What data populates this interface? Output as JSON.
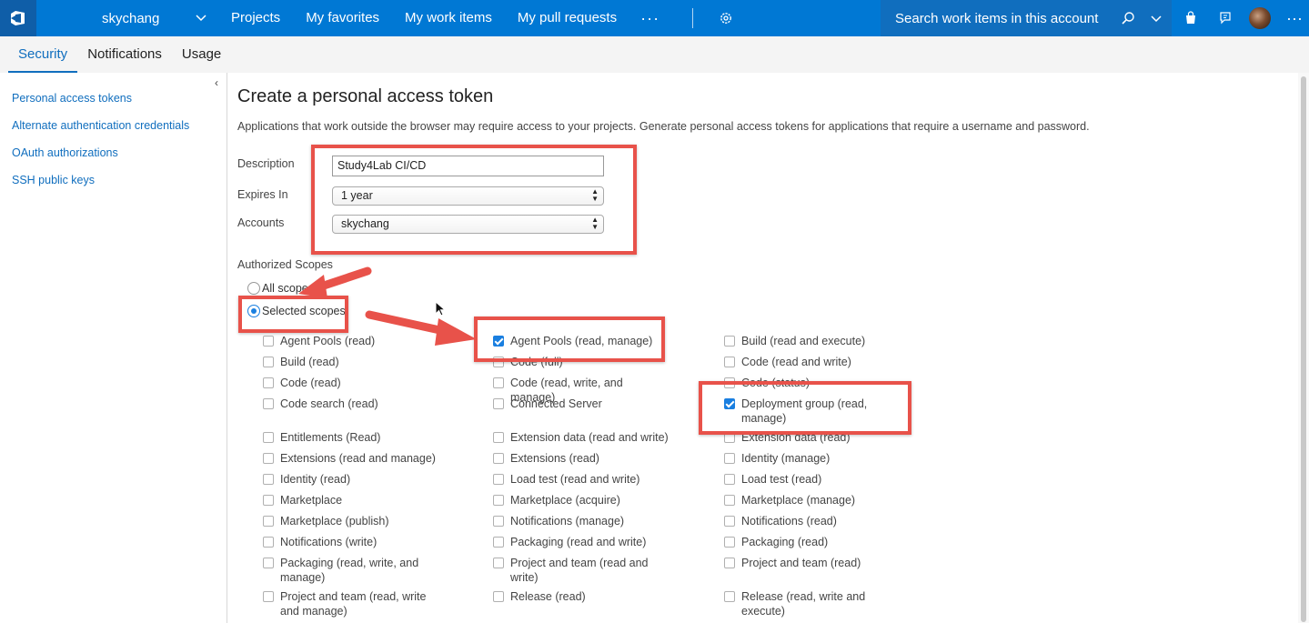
{
  "topbar": {
    "account_name": "skychang",
    "nav": [
      "Projects",
      "My favorites",
      "My work items",
      "My pull requests"
    ],
    "more_label": "···",
    "search_placeholder": "Search work items in this account"
  },
  "subnav": {
    "tabs": [
      "Security",
      "Notifications",
      "Usage"
    ],
    "active": "Security"
  },
  "sidebar": {
    "collapse_label": "‹",
    "links": [
      "Personal access tokens",
      "Alternate authentication credentials",
      "OAuth authorizations",
      "SSH public keys"
    ]
  },
  "form": {
    "title": "Create a personal access token",
    "intro": "Applications that work outside the browser may require access to your projects. Generate personal access tokens for applications that require a username and password.",
    "description_label": "Description",
    "description_value": "Study4Lab CI/CD",
    "expires_label": "Expires In",
    "expires_value": "1 year",
    "accounts_label": "Accounts",
    "accounts_value": "skychang",
    "scopes_label": "Authorized Scopes",
    "all_scopes_label": "All scopes",
    "selected_scopes_label": "Selected scopes",
    "scope_mode": "selected"
  },
  "scopes": {
    "col1": [
      {
        "label": "Agent Pools (read)",
        "checked": false
      },
      {
        "label": "Build (read)",
        "checked": false
      },
      {
        "label": "Code (read)",
        "checked": false
      },
      {
        "label": "Code search (read)",
        "checked": false
      },
      {
        "label": "Entitlements (Read)",
        "checked": false
      },
      {
        "label": "Extensions (read and manage)",
        "checked": false
      },
      {
        "label": "Identity (read)",
        "checked": false
      },
      {
        "label": "Marketplace",
        "checked": false
      },
      {
        "label": "Marketplace (publish)",
        "checked": false
      },
      {
        "label": "Notifications (write)",
        "checked": false
      },
      {
        "label": "Packaging (read, write, and manage)",
        "checked": false
      },
      {
        "label": "Project and team (read, write and manage)",
        "checked": false
      }
    ],
    "col2": [
      {
        "label": "Agent Pools (read, manage)",
        "checked": true
      },
      {
        "label": "Code (full)",
        "checked": false
      },
      {
        "label": "Code (read, write, and manage)",
        "checked": false
      },
      {
        "label": "Connected Server",
        "checked": false
      },
      {
        "label": "Extension data (read and write)",
        "checked": false
      },
      {
        "label": "Extensions (read)",
        "checked": false
      },
      {
        "label": "Load test (read and write)",
        "checked": false
      },
      {
        "label": "Marketplace (acquire)",
        "checked": false
      },
      {
        "label": "Notifications (manage)",
        "checked": false
      },
      {
        "label": "Packaging (read and write)",
        "checked": false
      },
      {
        "label": "Project and team (read and write)",
        "checked": false
      },
      {
        "label": "Release (read)",
        "checked": false
      }
    ],
    "col3": [
      {
        "label": "Build (read and execute)",
        "checked": false
      },
      {
        "label": "Code (read and write)",
        "checked": false
      },
      {
        "label": "Code (status)",
        "checked": false
      },
      {
        "label": "Deployment group (read, manage)",
        "checked": true
      },
      {
        "label": "Extension data (read)",
        "checked": false
      },
      {
        "label": "Identity (manage)",
        "checked": false
      },
      {
        "label": "Load test (read)",
        "checked": false
      },
      {
        "label": "Marketplace (manage)",
        "checked": false
      },
      {
        "label": "Notifications (read)",
        "checked": false
      },
      {
        "label": "Packaging (read)",
        "checked": false
      },
      {
        "label": "Project and team (read)",
        "checked": false
      },
      {
        "label": "Release (read, write and execute)",
        "checked": false
      }
    ]
  },
  "colors": {
    "brand": "#0078d4",
    "highlight": "#e8524a",
    "link": "#106ebe"
  }
}
